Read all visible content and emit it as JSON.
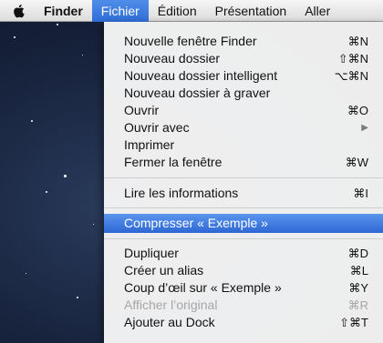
{
  "menubar": {
    "apple_icon": "apple-logo-icon",
    "app_name": "Finder",
    "menus": [
      "Fichier",
      "Édition",
      "Présentation",
      "Aller"
    ],
    "active_menu": "Fichier",
    "highlight_color": "#3a78de"
  },
  "dropdown": {
    "groups": [
      [
        {
          "label": "Nouvelle fenêtre Finder",
          "shortcut": "⌘N"
        },
        {
          "label": "Nouveau dossier",
          "shortcut": "⇧⌘N"
        },
        {
          "label": "Nouveau dossier intelligent",
          "shortcut": "⌥⌘N"
        },
        {
          "label": "Nouveau dossier à graver",
          "shortcut": ""
        },
        {
          "label": "Ouvrir",
          "shortcut": "⌘O"
        },
        {
          "label": "Ouvrir avec",
          "shortcut": "▶"
        },
        {
          "label": "Imprimer",
          "shortcut": ""
        },
        {
          "label": "Fermer la fenêtre",
          "shortcut": "⌘W"
        }
      ],
      [
        {
          "label": "Lire les informations",
          "shortcut": "⌘I"
        }
      ],
      [
        {
          "label": "Compresser « Exemple »",
          "shortcut": "",
          "selected": true
        }
      ],
      [
        {
          "label": "Dupliquer",
          "shortcut": "⌘D"
        },
        {
          "label": "Créer un alias",
          "shortcut": "⌘L"
        },
        {
          "label": "Coup d’œil sur « Exemple »",
          "shortcut": "⌘Y"
        },
        {
          "label": "Afficher l’original",
          "shortcut": "⌘R",
          "disabled": true
        },
        {
          "label": "Ajouter au Dock",
          "shortcut": "⇧⌘T"
        }
      ]
    ]
  }
}
